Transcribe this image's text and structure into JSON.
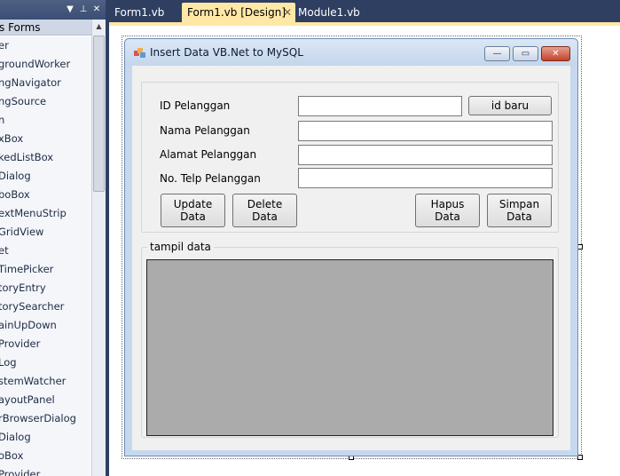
{
  "toolbox": {
    "header_buttons": [
      "▼",
      "⊥",
      "✕"
    ],
    "category": "s Forms",
    "items": [
      "er",
      "groundWorker",
      "ngNavigator",
      "ngSource",
      "n",
      "xBox",
      "kedListBox",
      "Dialog",
      "boBox",
      "extMenuStrip",
      "GridView",
      "et",
      "TimePicker",
      "toryEntry",
      "torySearcher",
      "ainUpDown",
      "Provider",
      "Log",
      "stemWatcher",
      "ayoutPanel",
      "rBrowserDialog",
      "Dialog",
      "oBox",
      "Provider"
    ]
  },
  "tabs": {
    "form1": "Form1.vb",
    "design": "Form1.vb [Design]",
    "module": "Module1.vb",
    "close_glyph": "✕"
  },
  "form": {
    "title": "Insert Data VB.Net to MySQL",
    "caption_buttons": {
      "minimize": "—",
      "maximize": "▭",
      "close": "✕"
    },
    "labels": {
      "id": "ID Pelanggan",
      "nama": "Nama Pelanggan",
      "alamat": "Alamat Pelanggan",
      "telp": "No. Telp Pelanggan"
    },
    "inputs": {
      "id": "",
      "nama": "",
      "alamat": "",
      "telp": ""
    },
    "buttons": {
      "id_baru": "id baru",
      "update": "Update\nData",
      "delete": "Delete\nData",
      "hapus": "Hapus\nData",
      "simpan": "Simpan\nData"
    },
    "group_label": "tampil data"
  },
  "colors": {
    "ide_dark": "#2e3f62",
    "active_tab": "#ffe8a6",
    "form_frame": "#c6d8ee",
    "client": "#f0f0f0",
    "datagrid": "#ababab"
  }
}
